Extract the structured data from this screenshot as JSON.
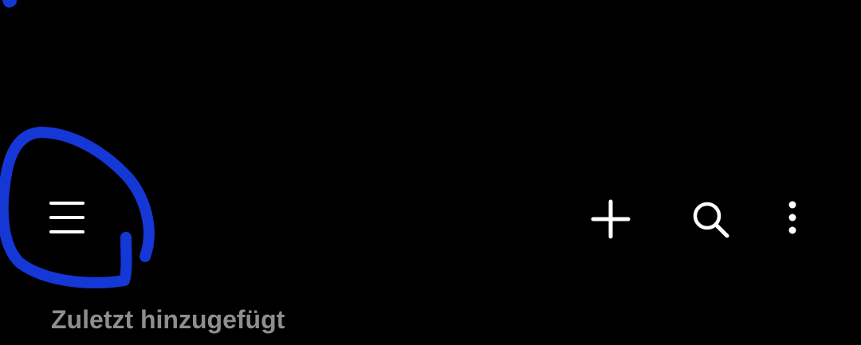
{
  "toolbar": {
    "menu_icon": "hamburger-menu-icon",
    "add_icon": "plus-icon",
    "search_icon": "search-icon",
    "more_icon": "more-vertical-icon"
  },
  "section": {
    "title": "Zuletzt hinzugefügt"
  },
  "colors": {
    "background": "#000000",
    "icon": "#ffffff",
    "section_title": "#8e8e8e",
    "annotation_stroke": "#1537d6"
  }
}
